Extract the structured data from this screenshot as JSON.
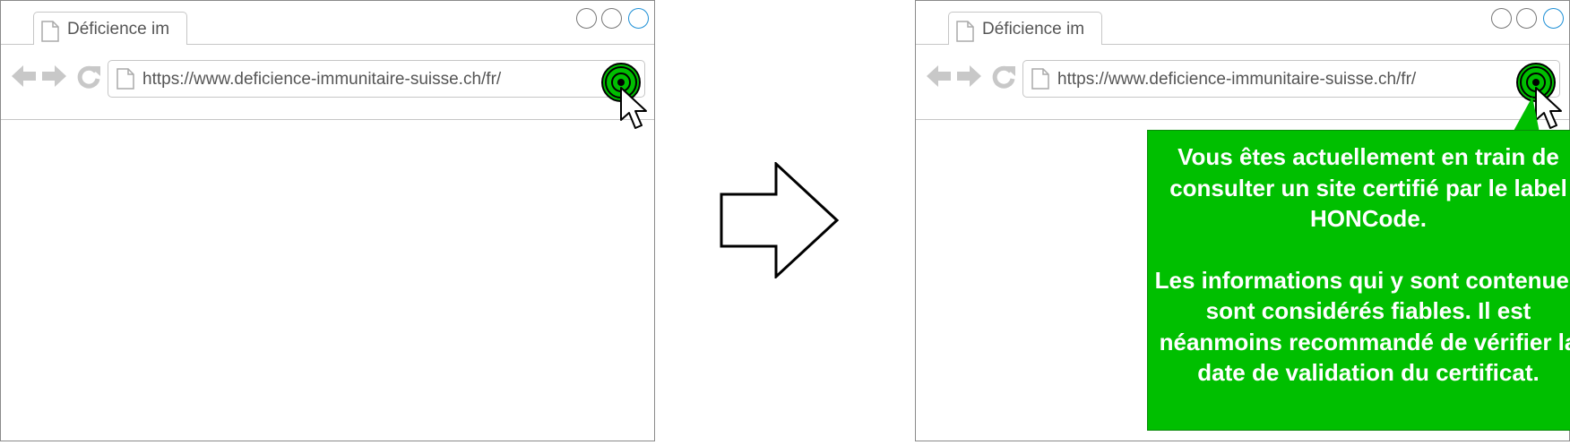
{
  "windows": [
    {
      "tab_title": "Déficience im",
      "url": "https://www.deficience-immunitaire-suisse.ch/fr/"
    },
    {
      "tab_title": "Déficience im",
      "url": "https://www.deficience-immunitaire-suisse.ch/fr/"
    }
  ],
  "tooltip": {
    "paragraph1": "Vous êtes actuellement en train de consulter un site certifié par le label HONCode.",
    "paragraph2": "Les informations qui y sont contenues sont considérés fiables. Il est néanmoins recommandé de vérifier la date de validation du certificat."
  },
  "colors": {
    "tooltip_bg": "#00bf00",
    "hon_green": "#00bf00",
    "window_accent": "#1e8fd6",
    "nav_icons": "#c8c8c8"
  },
  "icons": [
    "page-icon",
    "back-arrow-icon",
    "forward-arrow-icon",
    "reload-icon",
    "hon-badge-icon",
    "mouse-cursor-icon",
    "transition-arrow-icon"
  ]
}
